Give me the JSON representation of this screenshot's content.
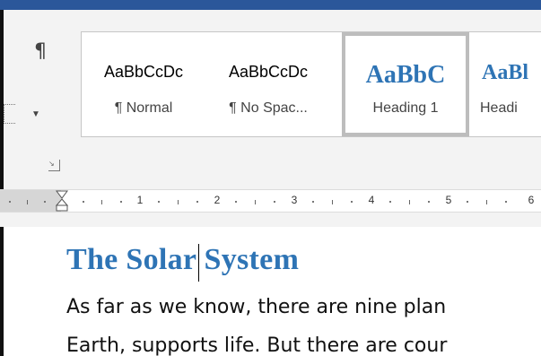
{
  "ribbon": {
    "paragraph_mark_icon": "¶",
    "styles_gallery": [
      {
        "sample": "AaBbCcDc",
        "label": "¶ Normal",
        "selected": false
      },
      {
        "sample": "AaBbCcDc",
        "label": "¶ No Spac...",
        "selected": false
      },
      {
        "sample": "AaBbC",
        "label": "Heading 1",
        "selected": true
      },
      {
        "sample": "AaBl",
        "label": "Headi",
        "selected": false
      }
    ],
    "launcher_icon": "dialog-launcher-icon"
  },
  "ruler": {
    "numbers": [
      "1",
      "2",
      "3",
      "4",
      "5",
      "6"
    ],
    "leading_tick": "1"
  },
  "document": {
    "title": "The Solar System",
    "lines": [
      "As far as we know, there are nine plan",
      "Earth, supports life. But there are cour"
    ]
  },
  "colors": {
    "title_bar": "#2b579a",
    "heading": "#2e74b5"
  }
}
